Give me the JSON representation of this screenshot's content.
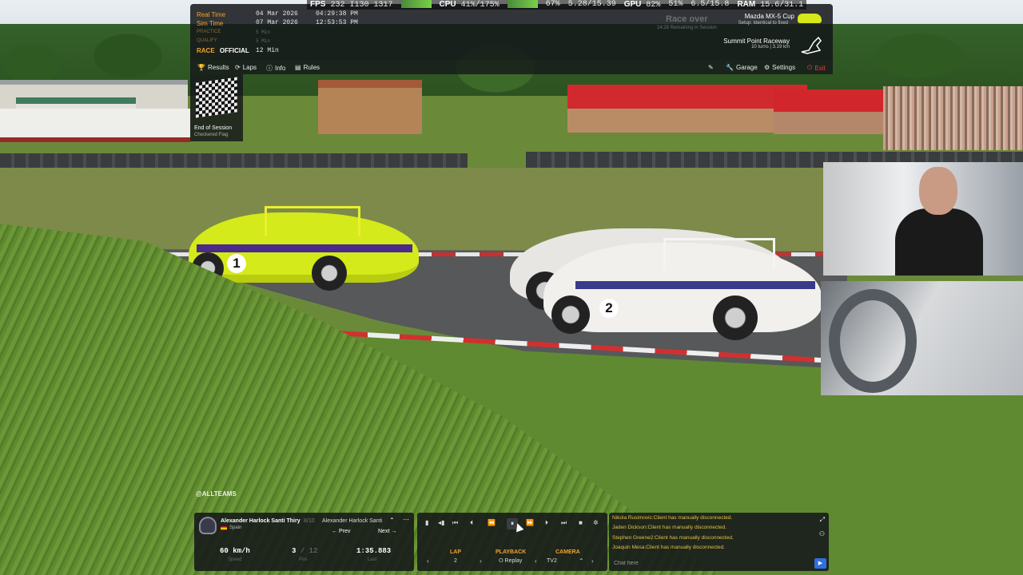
{
  "perf": {
    "fps_label": "FPS",
    "fps": "232",
    "misc": "I130 1317",
    "cpu_label": "CPU",
    "cpu": "41%/175%",
    "mem": "67%",
    "mem2": "5.28/15.39",
    "gpu_label": "GPU",
    "gpu": "82%",
    "gpu2": "51%",
    "vram": "6.5/15.8",
    "ram_label": "RAM",
    "ram": "15.6/31.1"
  },
  "session": {
    "real_time_label": "Real Time",
    "real_date": "04 Mar 2026",
    "real_clock": "04:29:38 PM",
    "sim_time_label": "Sim Time",
    "sim_date": "07 Mar 2026",
    "sim_clock": "12:53:53 PM",
    "practice_label": "PRACTICE",
    "practice_val": "5 Min",
    "qualify_label": "QUALIFY",
    "qualify_val": "5 Min",
    "race_label": "RACE",
    "race_status": "OFFICIAL",
    "race_val": "12 Min",
    "center_status": "Race over",
    "center_sub": "14:28 Remaining in Session"
  },
  "car": {
    "name": "Mazda MX-5 Cup",
    "setup": "Setup: Identical to fixed"
  },
  "track": {
    "name": "Summit Point Raceway",
    "info": "10 turns | 3.19 km"
  },
  "nav": {
    "results": "Results",
    "laps": "Laps",
    "info": "Info",
    "rules": "Rules",
    "garage": "Garage",
    "settings": "Settings",
    "exit": "Exit"
  },
  "flag": {
    "title": "End of Session",
    "subtitle": "Checkered Flag"
  },
  "stream": {
    "handle": "@ALLTEAMS"
  },
  "driver": {
    "name": "Alexander Harlock Santi Thiry",
    "position": "8/10",
    "country": "Spain",
    "selected": "Alexander Harlock Santi",
    "prev": "Prev",
    "next": "Next",
    "speed": "60 km/h",
    "speed_label": "Speed",
    "pos": "3",
    "pos_total": "/ 12",
    "pos_label": "Pos",
    "last": "1:35.883",
    "last_label": "Last"
  },
  "replay": {
    "lap_label": "LAP",
    "lap": "2",
    "playback_label": "PLAYBACK",
    "playback": "Replay",
    "camera_label": "CAMERA",
    "camera": "TV2"
  },
  "chat": {
    "messages": [
      "Nikola Rusimovic:Client has manually disconnected.",
      "Jaden Dickson:Client has manually disconnected.",
      "Stephen Greene2:Client has manually disconnected.",
      "Joaquin Mesa:Client has manually disconnected."
    ],
    "placeholder": "Chat here"
  },
  "car_numbers": {
    "yellow": "1",
    "white": "2"
  },
  "colors": {
    "accent": "#f3a42b",
    "chat_text": "#e6c040",
    "send": "#2f6fe0",
    "exit": "#e04040"
  }
}
